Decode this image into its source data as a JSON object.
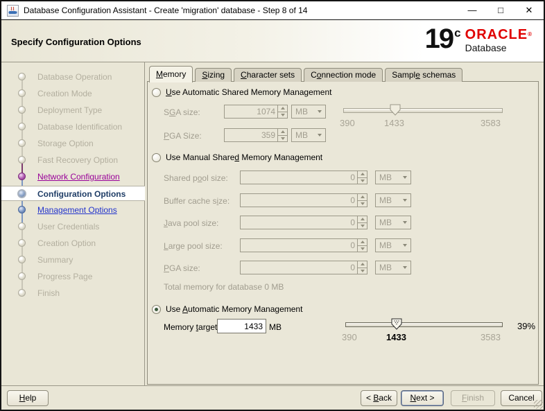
{
  "window": {
    "title": "Database Configuration Assistant - Create 'migration' database - Step 8 of 14",
    "controls": {
      "minimize": "—",
      "maximize": "□",
      "close": "✕"
    }
  },
  "header": {
    "title": "Specify Configuration Options",
    "logo": {
      "version_number": "19",
      "version_letter": "c",
      "brand": "ORACLE",
      "registered_mark": "®",
      "product": "Database"
    }
  },
  "sidebar": {
    "items": [
      {
        "label": "Database Operation",
        "state": "pending"
      },
      {
        "label": "Creation Mode",
        "state": "pending"
      },
      {
        "label": "Deployment Type",
        "state": "pending"
      },
      {
        "label": "Database Identification",
        "state": "pending"
      },
      {
        "label": "Storage Option",
        "state": "pending"
      },
      {
        "label": "Fast Recovery Option",
        "state": "pending"
      },
      {
        "label": "Network Configuration",
        "state": "visited"
      },
      {
        "label": "Configuration Options",
        "state": "current"
      },
      {
        "label": "Management Options",
        "state": "next"
      },
      {
        "label": "User Credentials",
        "state": "pending"
      },
      {
        "label": "Creation Option",
        "state": "pending"
      },
      {
        "label": "Summary",
        "state": "pending"
      },
      {
        "label": "Progress Page",
        "state": "pending"
      },
      {
        "label": "Finish",
        "state": "pending"
      }
    ]
  },
  "tabs": [
    {
      "pre": "",
      "key": "M",
      "post": "emory",
      "selected": true
    },
    {
      "pre": "",
      "key": "S",
      "post": "izing",
      "selected": false
    },
    {
      "pre": "",
      "key": "C",
      "post": "haracter sets",
      "selected": false
    },
    {
      "pre": "C",
      "key": "o",
      "post": "nnection mode",
      "selected": false
    },
    {
      "pre": "Sampl",
      "key": "e",
      "post": " schemas",
      "selected": false
    }
  ],
  "memory_tab": {
    "asmm": {
      "radio_label": {
        "pre": "",
        "key": "U",
        "post": "se Automatic Shared Memory Management"
      },
      "selected": false,
      "sga": {
        "label": {
          "pre": "S",
          "key": "G",
          "post": "A size:"
        },
        "value": "1074",
        "unit": "MB"
      },
      "pga": {
        "label": {
          "pre": "",
          "key": "P",
          "post": "GA Size:"
        },
        "value": "359",
        "unit": "MB"
      },
      "slider": {
        "min": 390,
        "max": 3583,
        "value": 1433,
        "min_label": "390",
        "mid_label": "1433",
        "max_label": "3583",
        "disabled": true
      }
    },
    "msmm": {
      "radio_label": {
        "pre": "Use Manual Share",
        "key": "d",
        "post": " Memory Management"
      },
      "selected": false,
      "rows": [
        {
          "label": {
            "pre": "Shared p",
            "key": "o",
            "post": "ol size:"
          },
          "value": "0",
          "unit": "MB"
        },
        {
          "label": {
            "pre": "Buffer cache s",
            "key": "i",
            "post": "ze:"
          },
          "value": "0",
          "unit": "MB"
        },
        {
          "label": {
            "pre": "",
            "key": "J",
            "post": "ava pool size:"
          },
          "value": "0",
          "unit": "MB"
        },
        {
          "label": {
            "pre": "",
            "key": "L",
            "post": "arge pool size:"
          },
          "value": "0",
          "unit": "MB"
        },
        {
          "label": {
            "pre": "",
            "key": "P",
            "post": "GA size:"
          },
          "value": "0",
          "unit": "MB"
        }
      ],
      "total_label": "Total memory for database 0 MB"
    },
    "amm": {
      "radio_label": {
        "pre": "Use ",
        "key": "A",
        "post": "utomatic Memory Management"
      },
      "selected": true,
      "target": {
        "label": {
          "pre": "Memory ",
          "key": "t",
          "post": "arget:"
        },
        "value": "1433",
        "unit": "MB"
      },
      "slider": {
        "min": 390,
        "max": 3583,
        "value": 1433,
        "min_label": "390",
        "mid_label": "1433",
        "max_label": "3583",
        "percent": "39%",
        "disabled": false
      }
    }
  },
  "footer": {
    "help": {
      "pre": "",
      "key": "H",
      "post": "elp"
    },
    "back": {
      "pre": "< ",
      "key": "B",
      "post": "ack"
    },
    "next": {
      "pre": "",
      "key": "N",
      "post": "ext >"
    },
    "finish": {
      "pre": "",
      "key": "F",
      "post": "inish"
    },
    "cancel": {
      "pre": "Cancel",
      "key": "",
      "post": ""
    }
  },
  "colors": {
    "oracle_red": "#e00000",
    "visited_step": "#990099",
    "next_step_link": "#2233cc",
    "current_step": "#1f3d66",
    "window_beige": "#e9e6d6"
  }
}
